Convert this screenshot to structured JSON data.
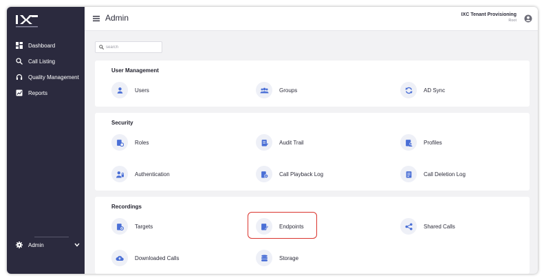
{
  "sidebar": {
    "logo_alt": "IXC Cloud",
    "items": [
      {
        "label": "Dashboard",
        "icon": "dashboard-icon"
      },
      {
        "label": "Call Listing",
        "icon": "search-icon"
      },
      {
        "label": "Quality Management",
        "icon": "headset-icon"
      },
      {
        "label": "Reports",
        "icon": "reports-icon"
      }
    ],
    "admin": {
      "label": "Admin",
      "icon": "gear-icon"
    }
  },
  "header": {
    "title": "Admin",
    "tenant_name": "IXC Tenant Provisioning",
    "tenant_sub": "Root"
  },
  "search": {
    "placeholder": "search",
    "value": ""
  },
  "sections": {
    "user_management": {
      "title": "User Management",
      "tiles": [
        "Users",
        "Groups",
        "AD Sync"
      ]
    },
    "security": {
      "title": "Security",
      "tiles": [
        "Roles",
        "Audit Trail",
        "Profiles",
        "Authentication",
        "Call Playback Log",
        "Call Deletion Log"
      ]
    },
    "recordings": {
      "title": "Recordings",
      "tiles": [
        "Targets",
        "Endpoints",
        "Shared Calls",
        "Downloaded Calls",
        "Storage"
      ]
    }
  },
  "colors": {
    "sidebar_bg": "#2b2a3e",
    "icon_accent": "#4a6fd6",
    "highlight": "#d9322b",
    "page_bg": "#f2f2f4"
  }
}
